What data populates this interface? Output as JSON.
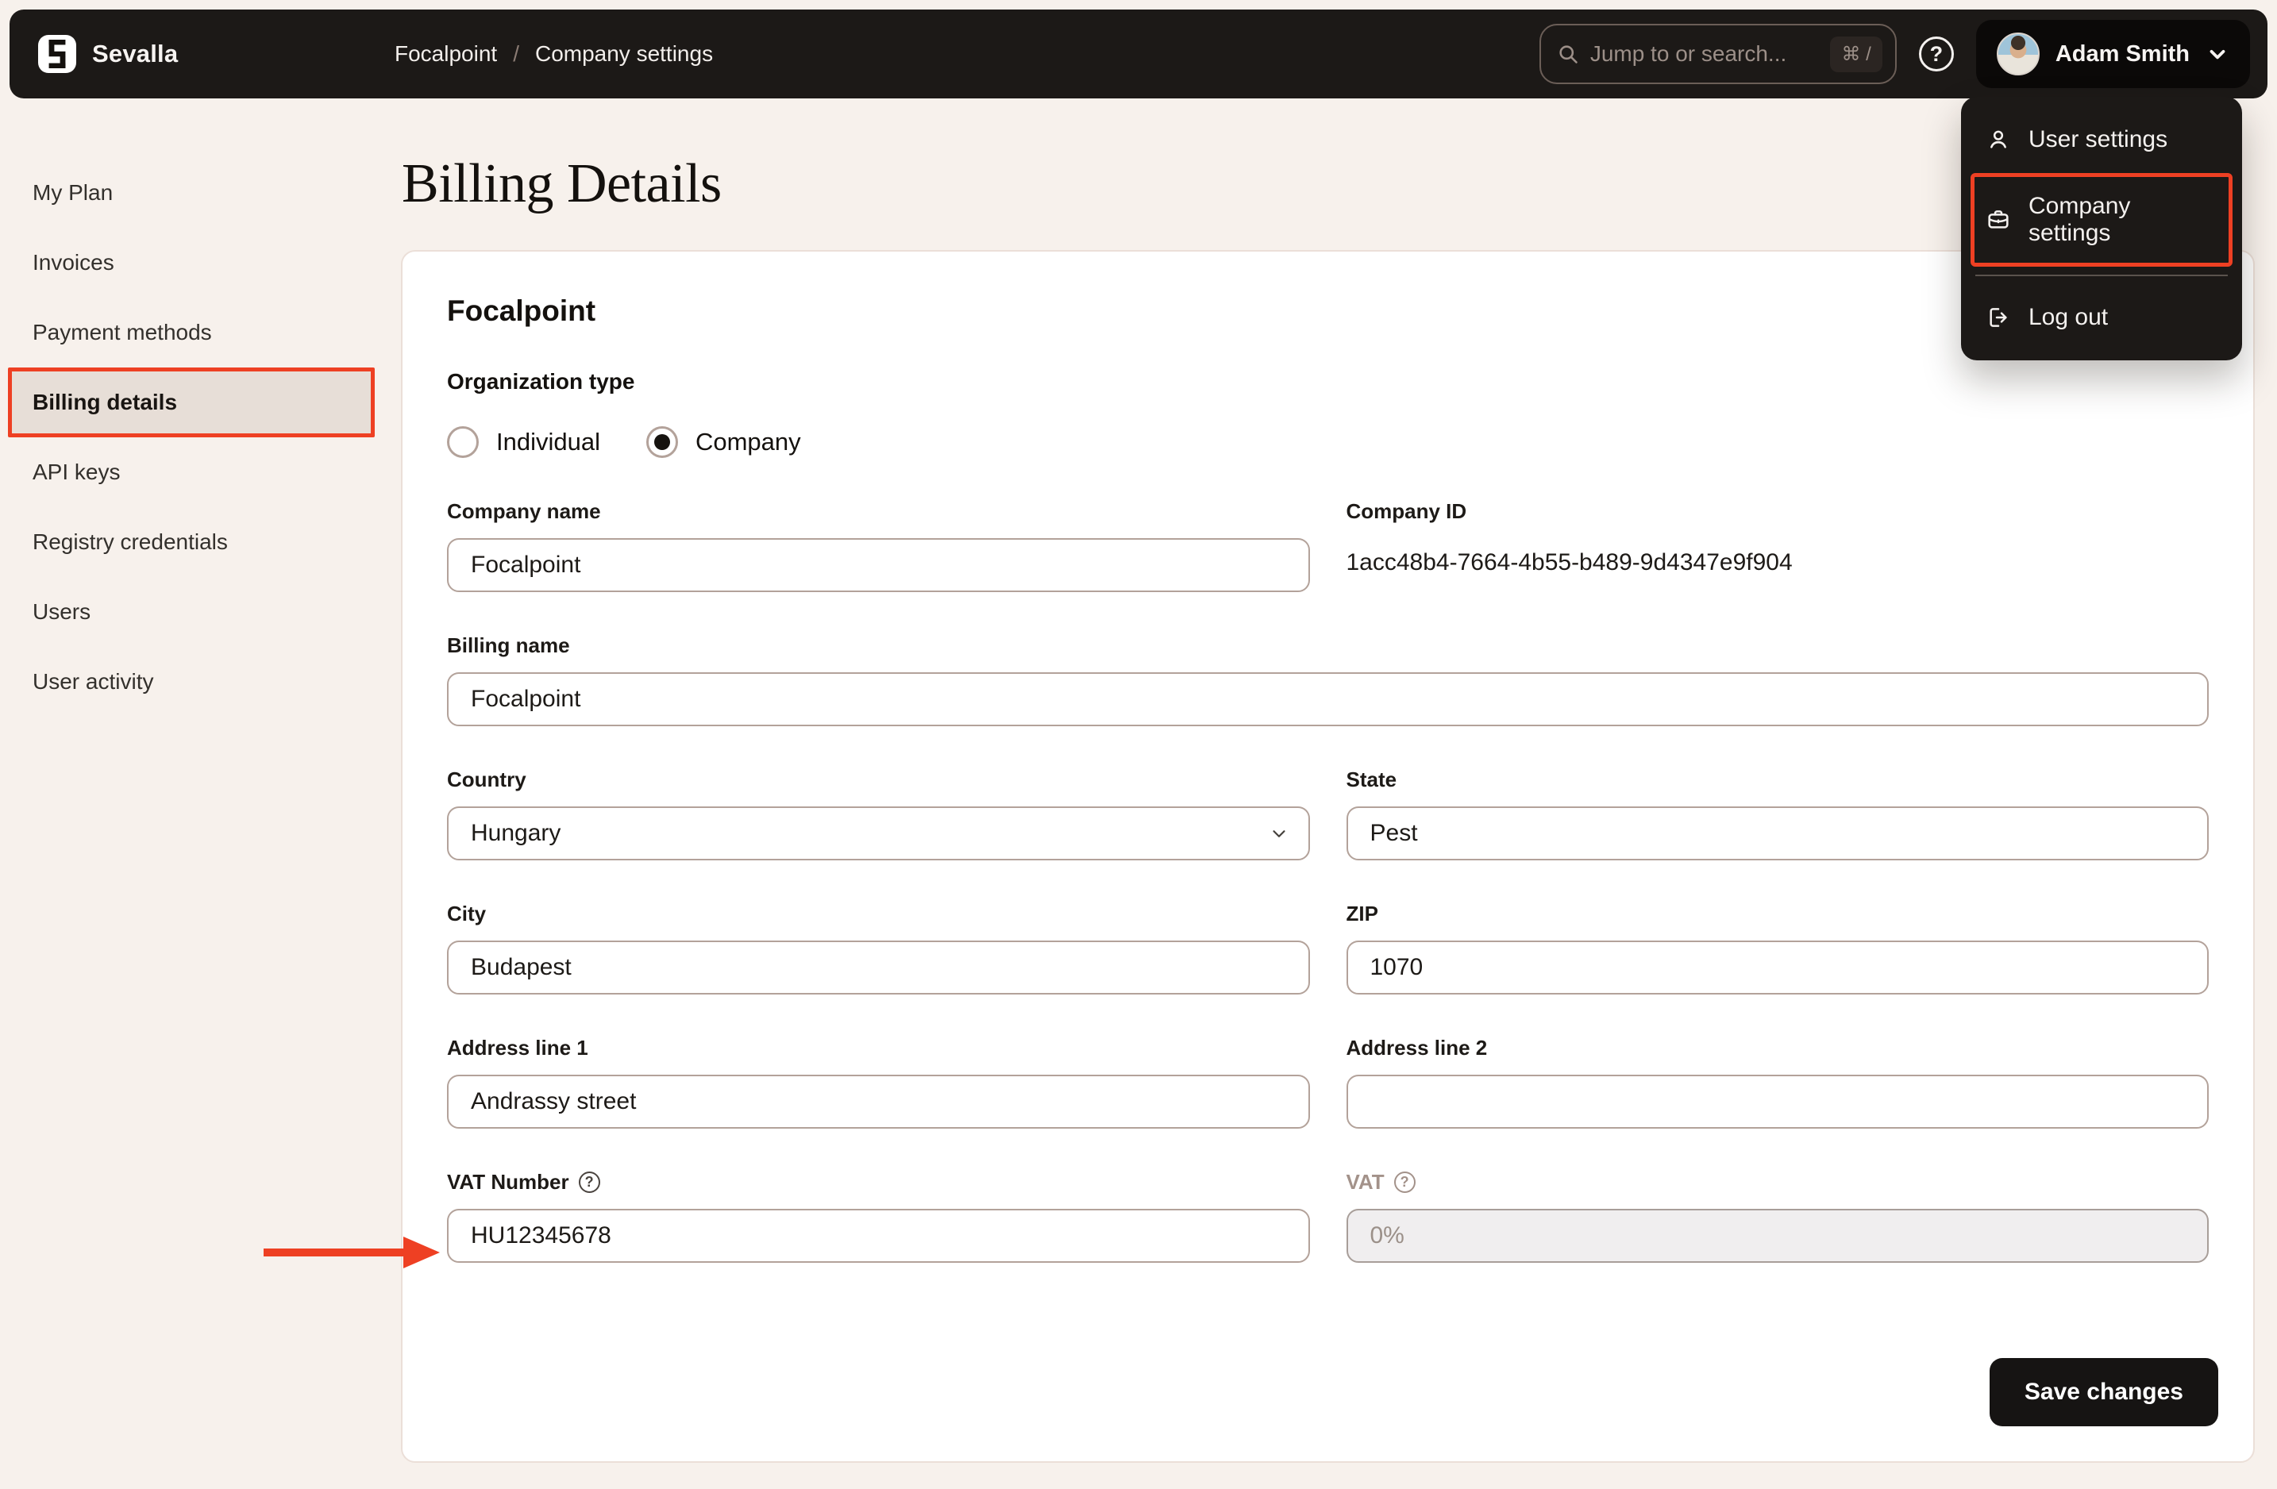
{
  "colors": {
    "accent_red": "#EE4023",
    "topbar_bg": "#1C1917",
    "page_bg": "#F7F1EC",
    "card_bg": "#FFFFFF",
    "sidebar_active_bg": "#E7DED7",
    "input_border": "#B3A29A",
    "disabled_text": "#9B9089",
    "button_bg": "#161413"
  },
  "topbar": {
    "brand": "Sevalla",
    "breadcrumb": {
      "org": "Focalpoint",
      "separator": "/",
      "page": "Company settings"
    },
    "search": {
      "placeholder": "Jump to or search...",
      "shortcut": "⌘ /"
    },
    "user_name": "Adam Smith"
  },
  "user_menu": {
    "items": [
      {
        "label": "User settings",
        "icon": "user-icon",
        "highlighted": false
      },
      {
        "label": "Company settings",
        "icon": "briefcase-icon",
        "highlighted": true
      },
      {
        "label": "Log out",
        "icon": "logout-icon",
        "highlighted": false
      }
    ]
  },
  "sidebar": {
    "items": [
      {
        "label": "My Plan",
        "active": false
      },
      {
        "label": "Invoices",
        "active": false
      },
      {
        "label": "Payment methods",
        "active": false
      },
      {
        "label": "Billing details",
        "active": true
      },
      {
        "label": "API keys",
        "active": false
      },
      {
        "label": "Registry credentials",
        "active": false
      },
      {
        "label": "Users",
        "active": false
      },
      {
        "label": "User activity",
        "active": false
      }
    ]
  },
  "page": {
    "title": "Billing Details"
  },
  "billing_form": {
    "company_heading": "Focalpoint",
    "organization_type": {
      "label": "Organization type",
      "options": [
        {
          "label": "Individual",
          "selected": false
        },
        {
          "label": "Company",
          "selected": true
        }
      ]
    },
    "company_name": {
      "label": "Company name",
      "value": "Focalpoint"
    },
    "company_id": {
      "label": "Company ID",
      "value": "1acc48b4-7664-4b55-b489-9d4347e9f904"
    },
    "billing_name": {
      "label": "Billing name",
      "value": "Focalpoint"
    },
    "country": {
      "label": "Country",
      "value": "Hungary"
    },
    "state": {
      "label": "State",
      "value": "Pest"
    },
    "city": {
      "label": "City",
      "value": "Budapest"
    },
    "zip": {
      "label": "ZIP",
      "value": "1070"
    },
    "address1": {
      "label": "Address line 1",
      "value": "Andrassy street"
    },
    "address2": {
      "label": "Address line 2",
      "value": ""
    },
    "vat_number": {
      "label": "VAT Number",
      "value": "HU12345678"
    },
    "vat": {
      "label": "VAT",
      "value": "0%",
      "disabled": true
    },
    "save_label": "Save changes"
  }
}
